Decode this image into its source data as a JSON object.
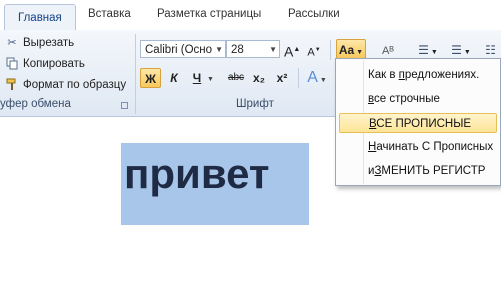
{
  "tabs": [
    {
      "label": "Главная",
      "active": true
    },
    {
      "label": "Вставка"
    },
    {
      "label": "Разметка страницы"
    },
    {
      "label": "Рассылки"
    }
  ],
  "clipboard": {
    "cut": "Вырезать",
    "copy": "Копировать",
    "format_painter": "Формат по образцу",
    "group_label": "уфер обмена"
  },
  "font": {
    "font_name": "Calibri (Осно",
    "font_size": "28",
    "bold": "Ж",
    "italic": "К",
    "underline": "Ч",
    "strikethrough": "abc",
    "subscript": "x₂",
    "superscript": "x²",
    "change_case": "Aa",
    "grow": "A",
    "shrink": "A",
    "group_label": "Шрифт"
  },
  "document": {
    "text": "привет"
  },
  "change_case_menu": {
    "items": [
      {
        "pre": "Как в ",
        "u": "п",
        "post": "редложениях."
      },
      {
        "pre": "",
        "u": "в",
        "post": "се строчные"
      },
      {
        "pre": "",
        "u": "В",
        "post": "СЕ ПРОПИСНЫЕ",
        "highlighted": true
      },
      {
        "pre": "",
        "u": "Н",
        "post": "ачинать С Прописных"
      },
      {
        "pre": "и",
        "u": "З",
        "post": "МЕНИТЬ РЕГИСТР"
      }
    ]
  },
  "colors": {
    "selection": "#a7c6ea",
    "menu_highlight": "#fde496",
    "pressed_button": "#f7c85d"
  }
}
